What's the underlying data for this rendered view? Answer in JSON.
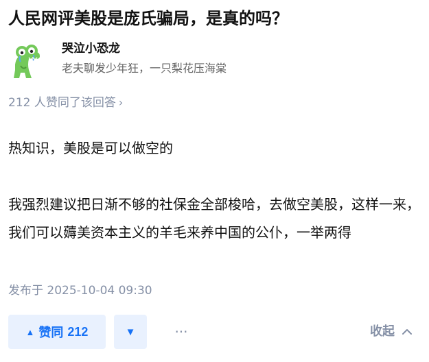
{
  "question": {
    "title": "人民网评美股是庞氏骗局，是真的吗？"
  },
  "author": {
    "avatar_icon": "crocodile-avatar-icon",
    "name": "哭泣小恐龙",
    "bio": "老夫聊发少年狂，一只梨花压海棠"
  },
  "upvote_summary": "212 人赞同了该回答",
  "answer": {
    "paragraphs": [
      "热知识，美股是可以做空的",
      "我强烈建议把日渐不够的社保金全部梭哈，去做空美股，这样一来，我们可以薅美资本主义的羊毛来养中国的公仆，一举两得"
    ],
    "published": "发布于 2025-10-04 09:30"
  },
  "actions": {
    "upvote_label": "赞同",
    "upvote_count": "212",
    "downvote_icon": "triangle-down-icon",
    "more_icon": "ellipsis-icon",
    "collapse_label": "收起"
  },
  "colors": {
    "accent": "#1772f6",
    "accent_bg": "#e9f1fe",
    "muted": "#8590a6",
    "avatar_green": "#74c95a"
  }
}
